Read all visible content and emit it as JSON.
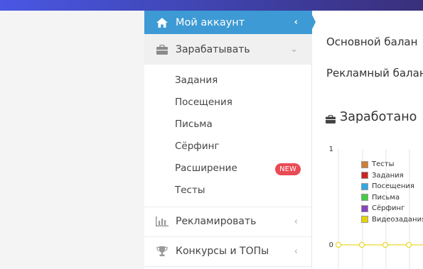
{
  "sidebar": {
    "account": {
      "label": "Мой аккаунт",
      "icon": "home-icon",
      "chevron": "‹"
    },
    "earn": {
      "label": "Зарабатывать",
      "icon": "briefcase-icon",
      "chevron": "⌄"
    },
    "earn_items": [
      "Задания",
      "Посещения",
      "Письма",
      "Сёрфинг",
      "Расширение",
      "Тесты"
    ],
    "new_badge": "NEW",
    "advertise": {
      "label": "Рекламировать",
      "icon": "bar-chart-icon",
      "chevron": "‹"
    },
    "contests": {
      "label": "Конкурсы и ТОПы",
      "icon": "trophy-icon",
      "chevron": "‹"
    }
  },
  "main": {
    "main_balance_label": "Основной балан",
    "ad_balance_label": "Рекламный балан",
    "earned_title": "Заработано"
  },
  "chart_data": {
    "type": "line",
    "y_ticks": [
      "1",
      "0"
    ],
    "ylim": [
      0,
      1
    ],
    "series": [
      {
        "name": "Тесты",
        "color": "#cd7f32"
      },
      {
        "name": "Задания",
        "color": "#cc2222"
      },
      {
        "name": "Посещения",
        "color": "#33a8e0"
      },
      {
        "name": "Письма",
        "color": "#44cc44"
      },
      {
        "name": "Сёрфинг",
        "color": "#8844bb"
      },
      {
        "name": "Видеозадания",
        "color": "#e6d200",
        "values": [
          0,
          0,
          0,
          0,
          0
        ]
      }
    ]
  },
  "colors": {
    "accent": "#3d9ad4",
    "badge": "#ea4a55"
  }
}
